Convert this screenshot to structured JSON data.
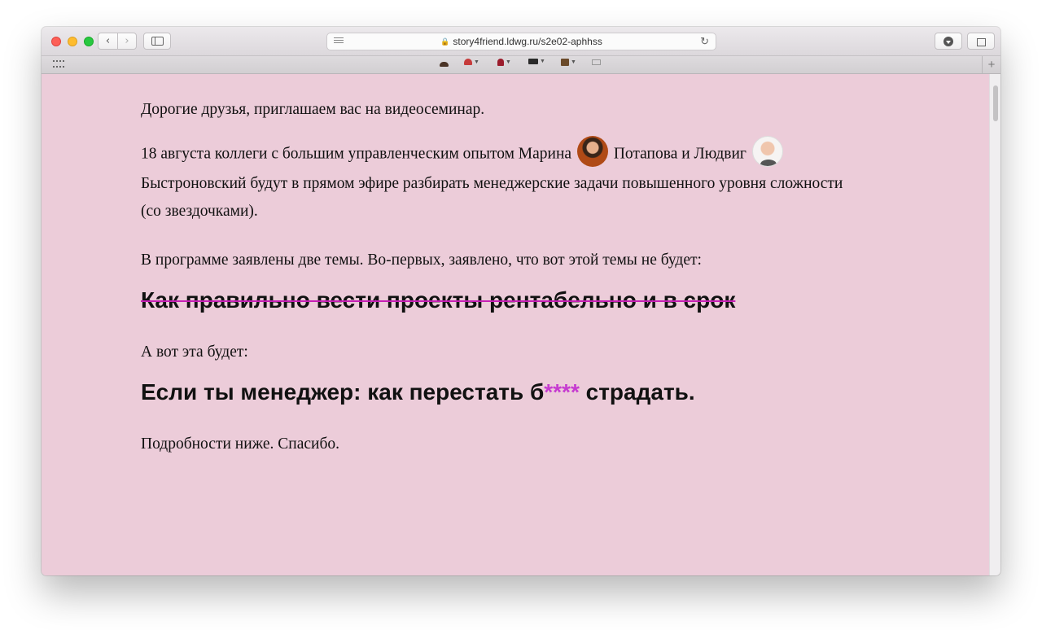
{
  "browser": {
    "url": "story4friend.ldwg.ru/s2e02-aphhss",
    "back_glyph": "‹",
    "forward_glyph": "›",
    "reload_glyph": "↻",
    "plus_glyph": "+",
    "favorites": [
      {
        "icon": "hedgehog-icon"
      },
      {
        "icon": "mushroom-icon",
        "has_menu": true
      },
      {
        "icon": "rose-icon",
        "has_menu": true
      },
      {
        "icon": "folder-icon",
        "has_menu": true
      },
      {
        "icon": "box-icon",
        "has_menu": true
      },
      {
        "icon": "mail-icon"
      }
    ]
  },
  "article": {
    "p1": "Дорогие друзья, приглашаем вас на видеосеминар.",
    "p2_before": "18 августа коллеги с большим управленческим опытом Марина ",
    "p2_middle": " Потапова и Людвиг ",
    "p2_after": " Быстроновский будут в прямом эфире разбирать менеджерские задачи повышенного уровня сложности (со звездочками).",
    "p3": "В программе заявлены две темы. Во-первых, заявлено, что вот этой темы не будет:",
    "struck_heading": "Как правильно вести проекты рентабельно и в срок",
    "p4": "А вот эта будет:",
    "main_heading_before": "Если ты менеджер: как перестать б",
    "main_heading_stars": "****",
    "main_heading_after": " страдать.",
    "p5": "Подробности ниже. Спасибо."
  },
  "colors": {
    "page_background": "#ecccd9",
    "strike_color": "#c71fb5",
    "stars_color": "#c63bd0"
  }
}
